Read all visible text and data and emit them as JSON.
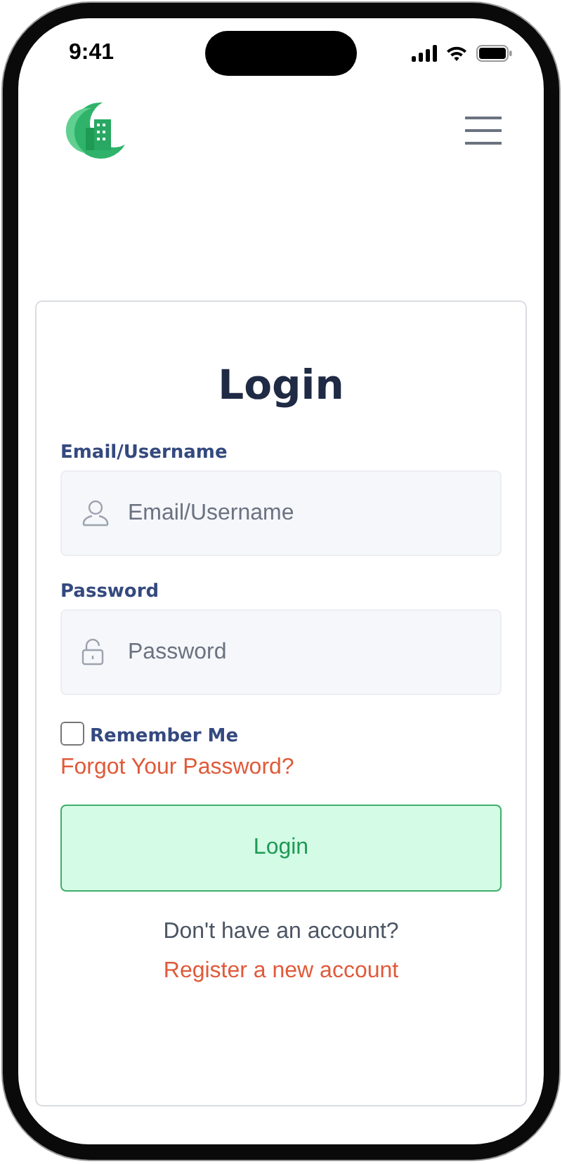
{
  "status_bar": {
    "time": "9:41"
  },
  "form": {
    "title": "Login",
    "fields": [
      {
        "kind": "email",
        "label": "Email/Username",
        "placeholder": "Email/Username"
      },
      {
        "kind": "password",
        "label": "Password",
        "placeholder": "Password"
      }
    ],
    "remember": {
      "label": "Remember Me",
      "checked": false
    },
    "forgot_link": "Forgot Your Password?",
    "submit_button": "Login",
    "signup_prompt": "Don't have an account?",
    "register_link": "Register a new account"
  }
}
